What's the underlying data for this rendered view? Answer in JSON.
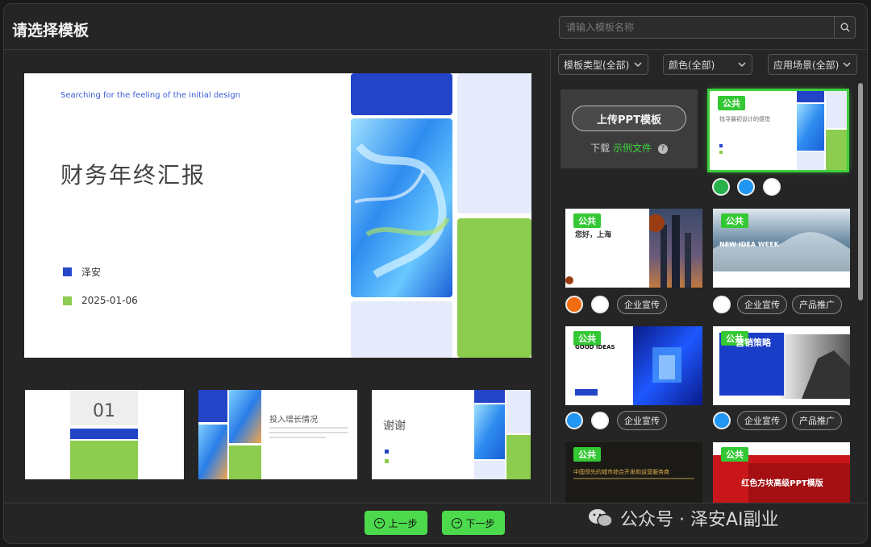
{
  "header": {
    "title": "请选择模板",
    "search_placeholder": "请输入模板名称"
  },
  "preview": {
    "tagline": "Searching for the feeling of the initial design",
    "title": "财务年终汇报",
    "author": "泽安",
    "date": "2025-01-06"
  },
  "thumbnails": [
    {
      "number": "01"
    },
    {
      "heading": "投入增长情况"
    },
    {
      "heading": "谢谢"
    }
  ],
  "filters": {
    "type": "模板类型(全部)",
    "color": "颜色(全部)",
    "scene": "应用场景(全部)"
  },
  "upload": {
    "button": "上传PPT模板",
    "download": "下载",
    "sample_link": "示例文件",
    "help": "?"
  },
  "badge_label": "公共",
  "templates": [
    {
      "title_text": "找寻最初设计的感觉",
      "colors": [
        "#27b14a",
        "#2196f3",
        "#ffffff"
      ],
      "tags": []
    },
    {
      "title_text": "您好，上海",
      "colors": [
        "#f26d12",
        "#ffffff"
      ],
      "tags": [
        "企业宣传"
      ]
    },
    {
      "title_text": "NEW IDEA WEEK",
      "colors": [
        "#ffffff"
      ],
      "tags": [
        "企业宣传",
        "产品推广"
      ]
    },
    {
      "title_text": "GOOD IDEAS",
      "colors": [
        "#2196f3",
        "#ffffff"
      ],
      "tags": [
        "企业宣传"
      ]
    },
    {
      "title_text": "营销策略",
      "colors": [
        "#2196f3"
      ],
      "tags": [
        "企业宣传",
        "产品推广"
      ]
    },
    {
      "title_text": "中国领先的城市综合开发和运营服务商",
      "colors": [],
      "tags": []
    },
    {
      "title_text": "红色方块高级PPT模版",
      "colors": [],
      "tags": []
    }
  ],
  "footer": {
    "prev": "上一步",
    "next": "下一步",
    "watermark": "公众号 · 泽安AI副业"
  },
  "colors": {
    "accent_green": "#4cd94c",
    "badge_green": "#34c834",
    "brand_blue": "#2647c9",
    "brand_green": "#8ccc4e"
  }
}
